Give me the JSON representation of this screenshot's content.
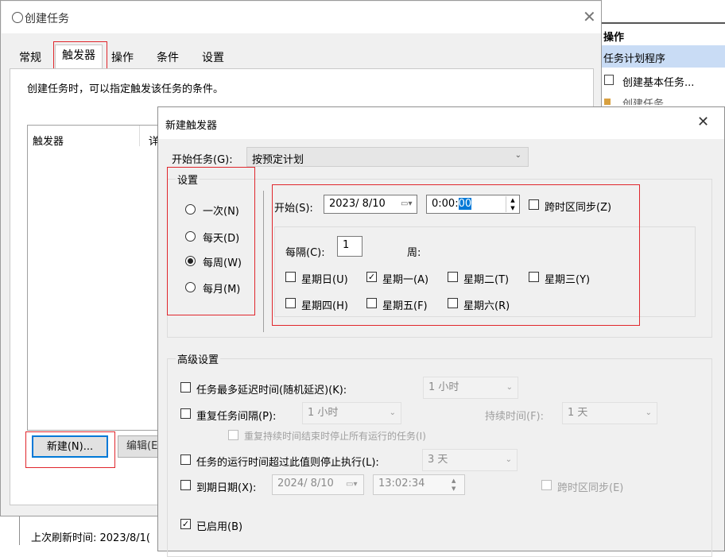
{
  "main_window": {
    "title": "创建任务",
    "tabs": [
      "常规",
      "触发器",
      "操作",
      "条件",
      "设置"
    ],
    "description": "创建任务时，可以指定触发该任务的条件。",
    "table_headers": [
      "触发器",
      "详"
    ],
    "new_button": "新建(N)...",
    "edit_button": "编辑(E"
  },
  "right_panel": {
    "header": "操作",
    "selected_item": "任务计划程序",
    "items": [
      "创建基本任务...",
      "创建任务..."
    ]
  },
  "status": {
    "last_refresh": "上次刷新时间: 2023/8/1("
  },
  "dialog": {
    "title": "新建触发器",
    "begin_task_label": "开始任务(G):",
    "begin_task_value": "按预定计划",
    "settings_label": "设置",
    "schedule_options": [
      "一次(N)",
      "每天(D)",
      "每周(W)",
      "每月(M)"
    ],
    "selected_option": 2,
    "start_label": "开始(S):",
    "start_date": "2023/ 8/10",
    "start_time_prefix": "0:00:",
    "start_time_selected": "00",
    "sync_label": "跨时区同步(Z)",
    "recur_label": "每隔(C):",
    "recur_value": "1",
    "recur_unit": "周:",
    "weekdays": [
      {
        "label": "星期日(U)",
        "checked": false
      },
      {
        "label": "星期一(A)",
        "checked": true
      },
      {
        "label": "星期二(T)",
        "checked": false
      },
      {
        "label": "星期三(Y)",
        "checked": false
      },
      {
        "label": "星期四(H)",
        "checked": false
      },
      {
        "label": "星期五(F)",
        "checked": false
      },
      {
        "label": "星期六(R)",
        "checked": false
      }
    ],
    "advanced_label": "高级设置",
    "delay_label": "任务最多延迟时间(随机延迟)(K):",
    "delay_value": "1 小时",
    "repeat_label": "重复任务间隔(P):",
    "repeat_value": "1 小时",
    "duration_label": "持续时间(F):",
    "duration_value": "1 天",
    "stop_all_label": "重复持续时间结束时停止所有运行的任务(I)",
    "stop_long_label": "任务的运行时间超过此值则停止执行(L):",
    "stop_long_value": "3 天",
    "expire_label": "到期日期(X):",
    "expire_date": "2024/ 8/10",
    "expire_time": "13:02:34",
    "expire_sync_label": "跨时区同步(E)",
    "enabled_label": "已启用(B)"
  },
  "colors": {
    "highlight_red": "#e0262c",
    "selection_blue": "#0078d7",
    "panel_selected": "#c9dcf5"
  }
}
